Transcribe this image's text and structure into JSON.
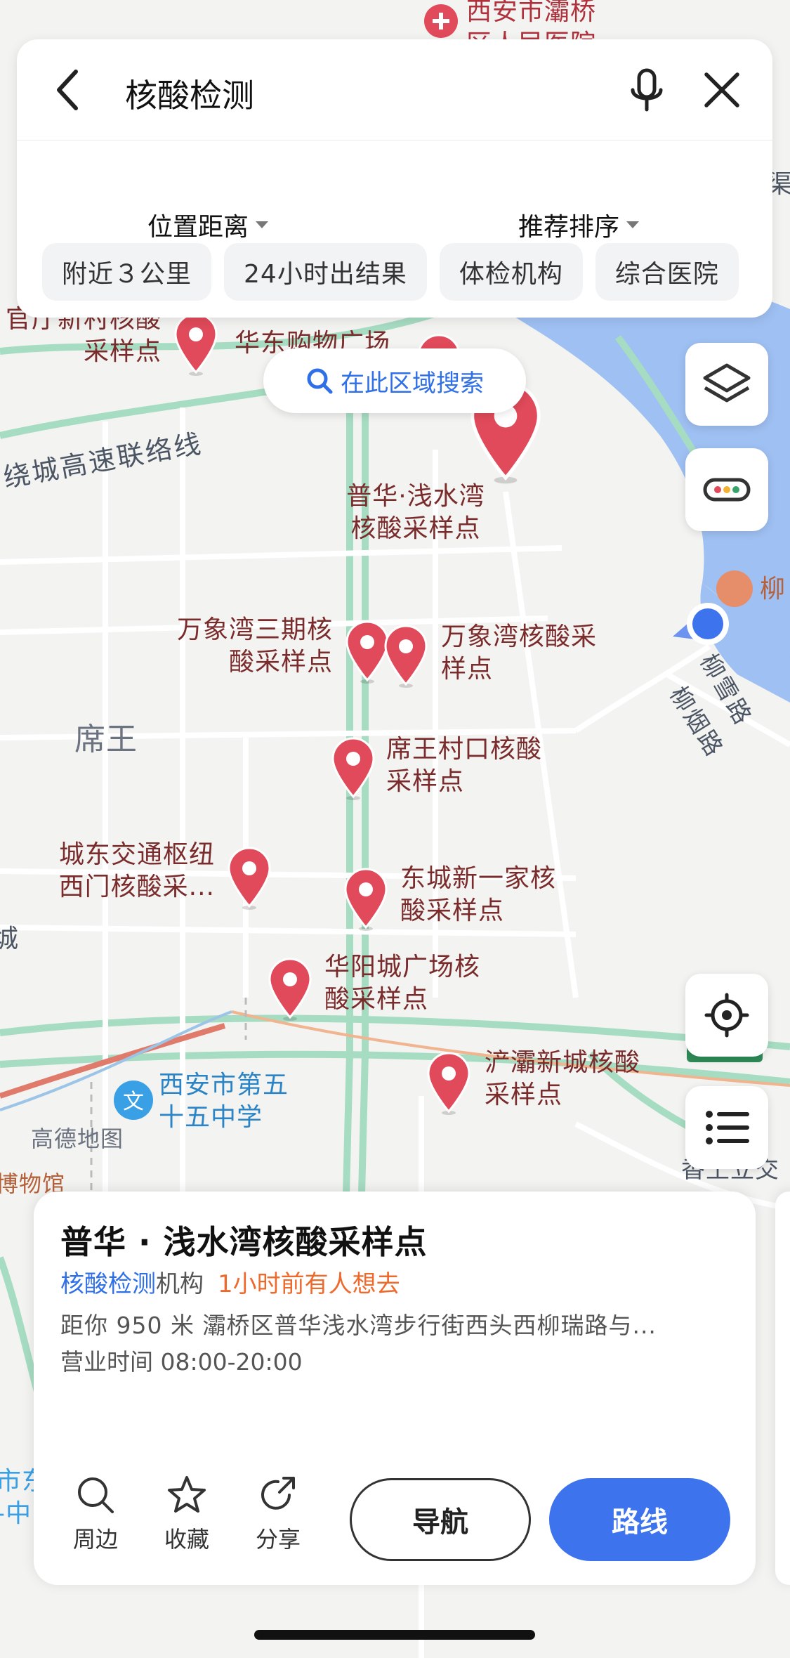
{
  "search": {
    "query": "核酸检测",
    "sort_distance": "位置距离",
    "sort_recommend": "推荐排序",
    "filters": [
      "附近３公里",
      "24小时出结果",
      "体检机构",
      "综合医院"
    ]
  },
  "area_search_label": "在此区域搜索",
  "map": {
    "pins": [
      {
        "label": "普华·浅水湾\n核酸采样点"
      },
      {
        "label": "万象湾三期核\n酸采样点"
      },
      {
        "label": "万象湾核酸采\n样点"
      },
      {
        "label": "席王村口核酸\n采样点"
      },
      {
        "label": "城东交通枢纽\n西门核酸采..."
      },
      {
        "label": "东城新一家核\n酸采样点"
      },
      {
        "label": "华阳城广场核\n酸采样点"
      },
      {
        "label": "浐灞新城核酸\n采样点"
      },
      {
        "label": "官厅新村核酸\n采样点"
      },
      {
        "label": "华东购物广场"
      }
    ],
    "places": {
      "hospital": "西安市灞桥\n区人民医院",
      "district": "席王",
      "school": "西安市第五\n十五中学",
      "temple": "柳",
      "museum": "博物馆",
      "highway": "绕城高速联络线",
      "road1": "柳雪路",
      "road2": "柳烟路",
      "edge_right": "香王立交",
      "edge_left": "城",
      "edge_bottom_left": "市东\n-中",
      "edge_top_right": "渠"
    },
    "watermark": "高德地图"
  },
  "poi": {
    "title": "普华 · 浅水湾核酸采样点",
    "category_link": "核酸检测",
    "category_suffix": "机构",
    "hint": "1小时前有人想去",
    "distance_address": "距你 950 米  灞桥区普华浅水湾步行街西头西柳瑞路与...",
    "hours": "营业时间 08:00-20:00",
    "actions": {
      "nearby": "周边",
      "favorite": "收藏",
      "share": "分享"
    },
    "nav_label": "导航",
    "route_label": "路线"
  },
  "colors": {
    "accent": "#3e73ee",
    "pin": "#e04a5a",
    "hint": "#ee6a2c",
    "road_green": "#a6dcc2",
    "water": "#9fc0f3"
  }
}
